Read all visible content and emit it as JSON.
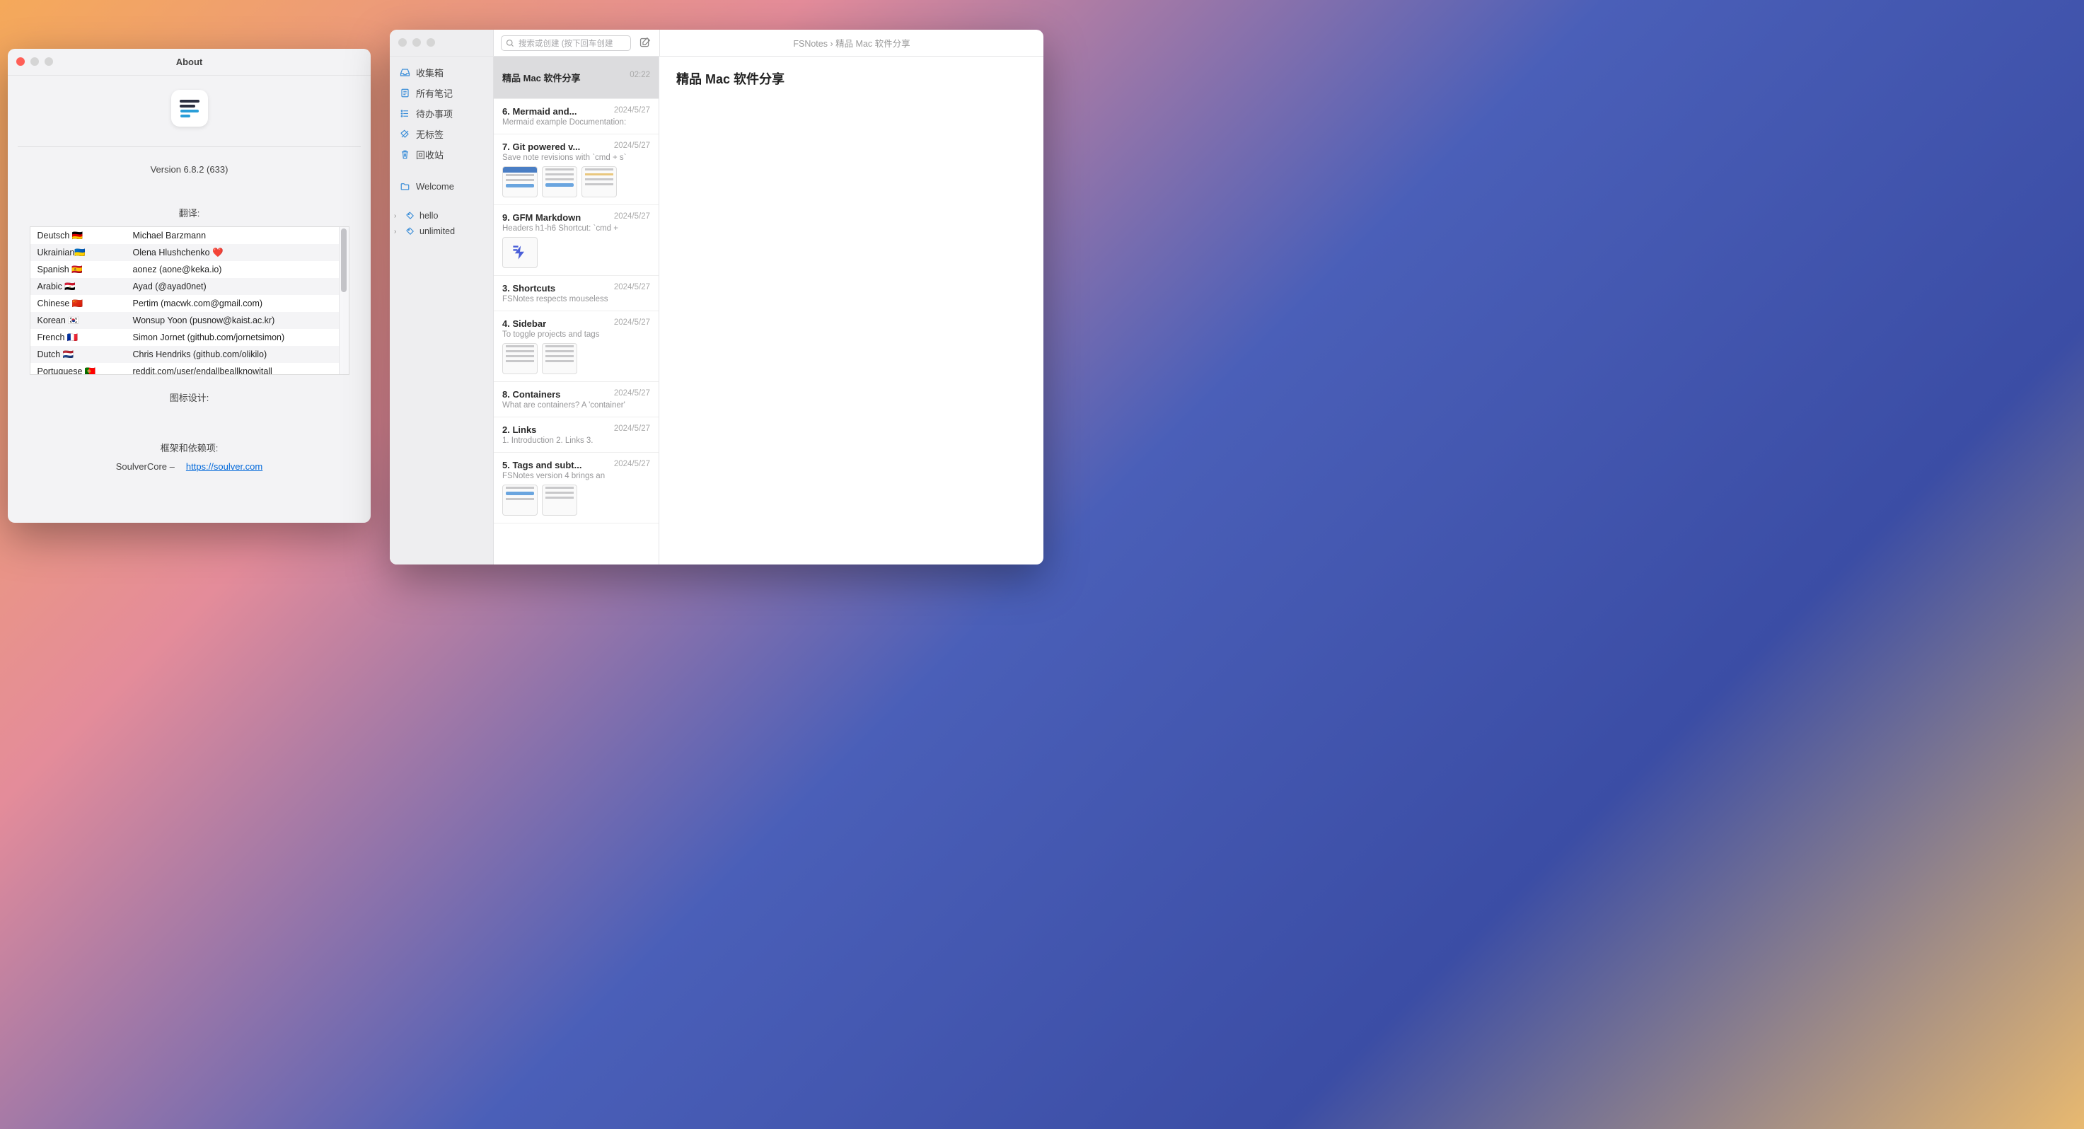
{
  "about": {
    "title": "About",
    "version": "Version 6.8.2 (633)",
    "translations_title": "翻译:",
    "translations": [
      {
        "lang": "Deutsch 🇩🇪",
        "person": "Michael Barzmann"
      },
      {
        "lang": "Ukrainian🇺🇦",
        "person": "Olena Hlushchenko ❤️"
      },
      {
        "lang": "Spanish 🇪🇸",
        "person": "aonez (aone@keka.io)"
      },
      {
        "lang": "Arabic 🇪🇬",
        "person": "Ayad (@ayad0net)"
      },
      {
        "lang": "Chinese 🇨🇳",
        "person": "Pertim (macwk.com@gmail.com)"
      },
      {
        "lang": "Korean 🇰🇷",
        "person": "Wonsup Yoon (pusnow@kaist.ac.kr)"
      },
      {
        "lang": "French 🇫🇷",
        "person": "Simon Jornet (github.com/jornetsimon)"
      },
      {
        "lang": "Dutch 🇳🇱",
        "person": "Chris Hendriks (github.com/olikilo)"
      },
      {
        "lang": "Portuguese 🇵🇹",
        "person": "reddit.com/user/endallbeallknowitall"
      }
    ],
    "icon_design_title": "图标设计:",
    "deps_title": "框架和依赖项:",
    "dep_name": "SoulverCore –",
    "dep_link": "https://soulver.com"
  },
  "fsnotes": {
    "search_placeholder": "搜索或创建 (按下回车创建",
    "breadcrumb": "FSNotes › 精品 Mac 软件分享",
    "sidebar": {
      "inbox": "收集箱",
      "all": "所有笔记",
      "todo": "待办事项",
      "untagged": "无标签",
      "trash": "回收站",
      "welcome": "Welcome",
      "tag_hello": "hello",
      "tag_unlimited": "unlimited"
    },
    "notes": [
      {
        "title": "精品 Mac 软件分享",
        "meta": "02:22",
        "preview": ""
      },
      {
        "title": "6. Mermaid and...",
        "meta": "2024/5/27",
        "preview": "Mermaid example Documentation:"
      },
      {
        "title": "7. Git powered v...",
        "meta": "2024/5/27",
        "preview": "Save note revisions with `cmd + s`"
      },
      {
        "title": "9. GFM Markdown",
        "meta": "2024/5/27",
        "preview": "Headers h1-h6 Shortcut: `cmd +"
      },
      {
        "title": "3. Shortcuts",
        "meta": "2024/5/27",
        "preview": "FSNotes respects mouseless"
      },
      {
        "title": "4. Sidebar",
        "meta": "2024/5/27",
        "preview": "To toggle projects and tags"
      },
      {
        "title": "8. Containers",
        "meta": "2024/5/27",
        "preview": "What are containers? A 'container'"
      },
      {
        "title": "2. Links",
        "meta": "2024/5/27",
        "preview": "1. Introduction 2. Links 3."
      },
      {
        "title": "5. Tags and subt...",
        "meta": "2024/5/27",
        "preview": "FSNotes version 4 brings an"
      }
    ],
    "content_title": "精品 Mac 软件分享"
  }
}
